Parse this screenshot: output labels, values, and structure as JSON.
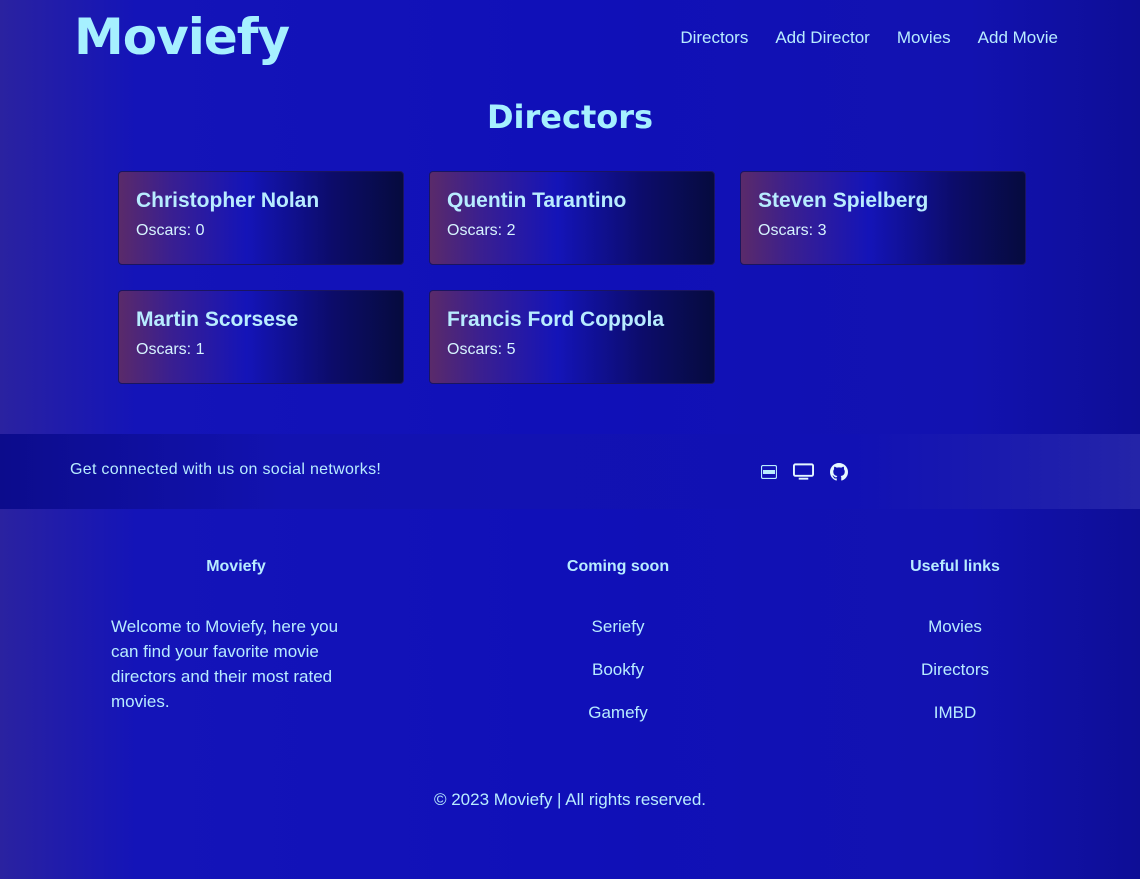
{
  "header": {
    "logo": "Moviefy",
    "nav": [
      "Directors",
      "Add Director",
      "Movies",
      "Add Movie"
    ]
  },
  "main": {
    "title": "Directors",
    "directors": [
      {
        "name": "Christopher Nolan",
        "oscars": "Oscars: 0"
      },
      {
        "name": "Quentin Tarantino",
        "oscars": "Oscars: 2"
      },
      {
        "name": "Steven Spielberg",
        "oscars": "Oscars: 3"
      },
      {
        "name": "Martin Scorsese",
        "oscars": "Oscars: 1"
      },
      {
        "name": "Francis Ford Coppola",
        "oscars": "Oscars: 5"
      }
    ]
  },
  "social": {
    "text": "Get connected with us on social networks!",
    "icons": [
      "imdb-icon",
      "tv-icon",
      "github-icon"
    ]
  },
  "footer": {
    "about": {
      "heading": "Moviefy",
      "description": "Welcome to Moviefy, here you can find your favorite movie directors and their most rated movies."
    },
    "coming_soon": {
      "heading": "Coming soon",
      "links": [
        "Seriefy",
        "Bookfy",
        "Gamefy"
      ]
    },
    "useful_links": {
      "heading": "Useful links",
      "links": [
        "Movies",
        "Directors",
        "IMBD"
      ]
    },
    "copyright": "© 2023 Moviefy | All rights reserved."
  },
  "colors": {
    "accent": "#a6f0ff",
    "text": "#b8ecff",
    "background": "#1212b0"
  }
}
